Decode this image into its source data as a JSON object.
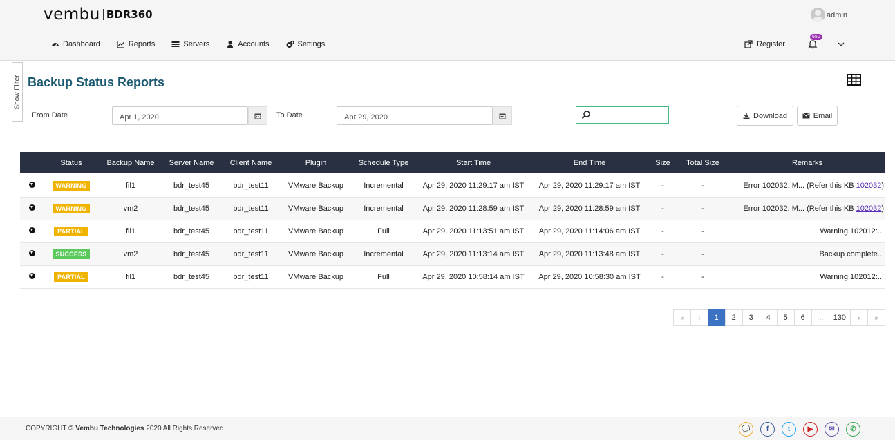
{
  "brand": {
    "name": "vembu",
    "product": "BDR360"
  },
  "user": {
    "name": "admin"
  },
  "nav": {
    "items": [
      {
        "label": "Dashboard",
        "icon": "dashboard-icon"
      },
      {
        "label": "Reports",
        "icon": "chart-icon"
      },
      {
        "label": "Servers",
        "icon": "servers-icon"
      },
      {
        "label": "Accounts",
        "icon": "user-icon"
      },
      {
        "label": "Settings",
        "icon": "gears-icon"
      }
    ],
    "register_label": "Register",
    "notification_count": "650"
  },
  "sidebar": {
    "show_filter_label": "Show Filter"
  },
  "page": {
    "title": "Backup Status Reports"
  },
  "filters": {
    "from_label": "From Date",
    "from_value": "Apr 1, 2020",
    "to_label": "To Date",
    "to_value": "Apr 29, 2020",
    "search_value": "",
    "download_label": "Download",
    "email_label": "Email"
  },
  "table": {
    "columns": [
      "",
      "Status",
      "Backup Name",
      "Server Name",
      "Client Name",
      "Plugin",
      "Schedule Type",
      "Start Time",
      "End Time",
      "Size",
      "Total Size",
      "Remarks"
    ],
    "rows": [
      {
        "status": "WARNING",
        "backup": "fil1",
        "server": "bdr_test45",
        "client": "bdr_test11",
        "plugin": "VMware Backup",
        "schedule": "Incremental",
        "start": "Apr 29, 2020 11:29:17 am IST",
        "end": "Apr 29, 2020 11:29:17 am IST",
        "size": "-",
        "total": "-",
        "remarks": "Error 102032: M... (Refer this KB ",
        "link": "102032"
      },
      {
        "status": "WARNING",
        "backup": "vm2",
        "server": "bdr_test45",
        "client": "bdr_test11",
        "plugin": "VMware Backup",
        "schedule": "Incremental",
        "start": "Apr 29, 2020 11:28:59 am IST",
        "end": "Apr 29, 2020 11:28:59 am IST",
        "size": "-",
        "total": "-",
        "remarks": "Error 102032: M... (Refer this KB ",
        "link": "102032"
      },
      {
        "status": "PARTIAL",
        "backup": "fil1",
        "server": "bdr_test45",
        "client": "bdr_test11",
        "plugin": "VMware Backup",
        "schedule": "Full",
        "start": "Apr 29, 2020 11:13:51 am IST",
        "end": "Apr 29, 2020 11:14:06 am IST",
        "size": "-",
        "total": "-",
        "remarks": "Warning 102012:...",
        "link": ""
      },
      {
        "status": "SUCCESS",
        "backup": "vm2",
        "server": "bdr_test45",
        "client": "bdr_test11",
        "plugin": "VMware Backup",
        "schedule": "Incremental",
        "start": "Apr 29, 2020 11:13:14 am IST",
        "end": "Apr 29, 2020 11:13:48 am IST",
        "size": "-",
        "total": "-",
        "remarks": "Backup complete...",
        "link": ""
      },
      {
        "status": "PARTIAL",
        "backup": "fil1",
        "server": "bdr_test45",
        "client": "bdr_test11",
        "plugin": "VMware Backup",
        "schedule": "Full",
        "start": "Apr 29, 2020 10:58:14 am IST",
        "end": "Apr 29, 2020 10:58:30 am IST",
        "size": "-",
        "total": "-",
        "remarks": "Warning 102012:...",
        "link": ""
      }
    ]
  },
  "status_colors": {
    "WARNING": "#f0b400",
    "PARTIAL": "#f0b400",
    "SUCCESS": "#5cc95c"
  },
  "pagination": {
    "pages": [
      "«",
      "‹",
      "1",
      "2",
      "3",
      "4",
      "5",
      "6",
      "...",
      "130",
      "›",
      "»"
    ],
    "active": "1"
  },
  "footer": {
    "copyright_prefix": "COPYRIGHT © ",
    "company": "Vembu Technologies",
    "copyright_suffix": " 2020 All Rights Reserved",
    "social": [
      {
        "name": "chat-icon",
        "color": "#f0a830",
        "glyph": "💬"
      },
      {
        "name": "facebook-icon",
        "color": "#3b5998",
        "glyph": "f"
      },
      {
        "name": "twitter-icon",
        "color": "#1da1f2",
        "glyph": "t"
      },
      {
        "name": "youtube-icon",
        "color": "#cc2020",
        "glyph": "▶"
      },
      {
        "name": "email-icon",
        "color": "#5a4aa8",
        "glyph": "✉"
      },
      {
        "name": "whatsapp-icon",
        "color": "#2fa84f",
        "glyph": "✆"
      }
    ]
  }
}
